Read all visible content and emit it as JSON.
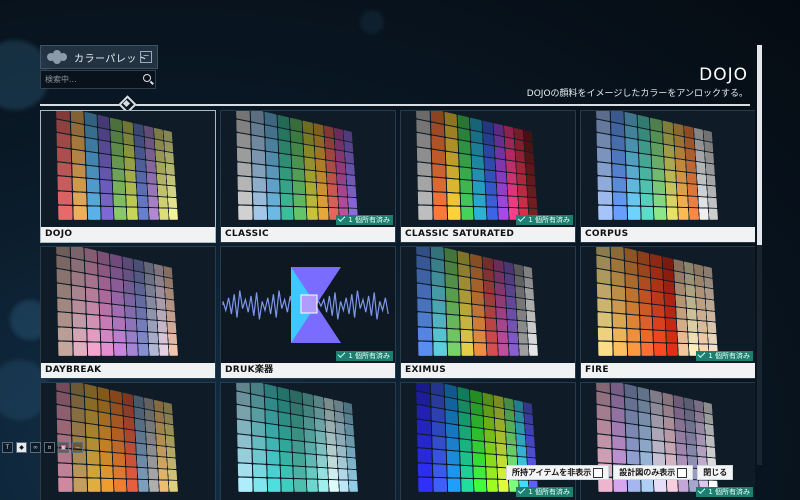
{
  "sidebar": {
    "title": "カラーパレット",
    "collapse_icon": "minus-square-icon",
    "search": {
      "placeholder": "検索中..."
    }
  },
  "header": {
    "title": "DOJO",
    "subtitle": "DOJOの顔料をイメージしたカラーをアンロックする。"
  },
  "cards": [
    {
      "label": "DOJO",
      "owned": false,
      "selected": true,
      "colors": [
        "#e96a6a",
        "#f0b15c",
        "#5cb3e8",
        "#7e6ad6",
        "#8acb6b",
        "#c9d75b",
        "#6b7fd0",
        "#b28ad4",
        "#e0e07a",
        "#f4f49a"
      ]
    },
    {
      "label": "CLASSIC",
      "owned": true,
      "colors": [
        "#d3d3d3",
        "#a5c9ea",
        "#6fbbe6",
        "#3fbf9b",
        "#66c56a",
        "#c7c53c",
        "#e8aa39",
        "#e8665d",
        "#c24fa5",
        "#8f6be0"
      ]
    },
    {
      "label": "CLASSIC SATURATED",
      "owned": true,
      "colors": [
        "#c0c0c0",
        "#ff7a3c",
        "#ffd33a",
        "#47d45c",
        "#2ab5d9",
        "#3f64e6",
        "#a84be8",
        "#ff3f8c",
        "#d9304a",
        "#7a2020"
      ]
    },
    {
      "label": "CORPUS",
      "owned": false,
      "colors": [
        "#a8c6ff",
        "#6aa1ff",
        "#6fd5ff",
        "#5de0c8",
        "#8ee98a",
        "#e7e36a",
        "#ffbb55",
        "#ff8a44",
        "#f2f2f2",
        "#cfcfcf"
      ]
    },
    {
      "label": "DAYBREAK",
      "owned": false,
      "colors": [
        "#c8a9a0",
        "#e2b2c0",
        "#f4a7cf",
        "#e58fd2",
        "#c987dd",
        "#a586d6",
        "#8890d5",
        "#b5b9d8",
        "#e8d3e6",
        "#f3c7b0"
      ]
    },
    {
      "label": "DRUK楽器",
      "owned": true,
      "icon": "druk-instrument-icon",
      "colors": []
    },
    {
      "label": "EXIMUS",
      "owned": false,
      "colors": [
        "#5a8ff0",
        "#5ed0e0",
        "#7ad36a",
        "#e6d04a",
        "#f09040",
        "#d65050",
        "#c050a0",
        "#8860d0",
        "#a0a0a0",
        "#e8e8e8"
      ]
    },
    {
      "label": "FIRE",
      "owned": true,
      "colors": [
        "#ffe08a",
        "#ffc060",
        "#ff9a40",
        "#ff7030",
        "#ff4a20",
        "#e43018",
        "#f6c8a0",
        "#fff0c0",
        "#ffd8b0",
        "#fbe3c9"
      ]
    },
    {
      "label": "",
      "owned": false,
      "colors": [
        "#d08aa0",
        "#c6a060",
        "#e0b040",
        "#f0a030",
        "#f08030",
        "#e86040",
        "#80a0c0",
        "#b0b0b0",
        "#f0c070",
        "#e0d080"
      ]
    },
    {
      "label": "",
      "owned": false,
      "colors": [
        "#b0f0ff",
        "#80e8f0",
        "#50e0e0",
        "#40d0c0",
        "#50c0b0",
        "#70d8d0",
        "#a0f0f0",
        "#e0ffff",
        "#c0e8f8",
        "#90d0e8"
      ]
    },
    {
      "label": "",
      "owned": true,
      "colors": [
        "#3030ff",
        "#4060ff",
        "#20a0ff",
        "#20e0a0",
        "#40ff40",
        "#a0ff20",
        "#e0ff40",
        "#80ff80",
        "#40e0ff",
        "#6060ff"
      ]
    },
    {
      "label": "",
      "owned": true,
      "colors": [
        "#f0b8d0",
        "#d8a8f0",
        "#a8b8f0",
        "#b0d0f8",
        "#e8e0f8",
        "#f8d0e0",
        "#c8a8d8",
        "#a8a8d0",
        "#e0c8f0",
        "#ffffff"
      ]
    }
  ],
  "owned_badge_text": "1 個所有済み",
  "toolbar": {
    "hide_owned_label": "所持アイテムを非表示",
    "blueprint_only_label": "設計図のみ表示",
    "close_label": "閉じる"
  },
  "mini_icons": [
    "T",
    "shield",
    "pad",
    "lock",
    "box",
    "minus"
  ]
}
